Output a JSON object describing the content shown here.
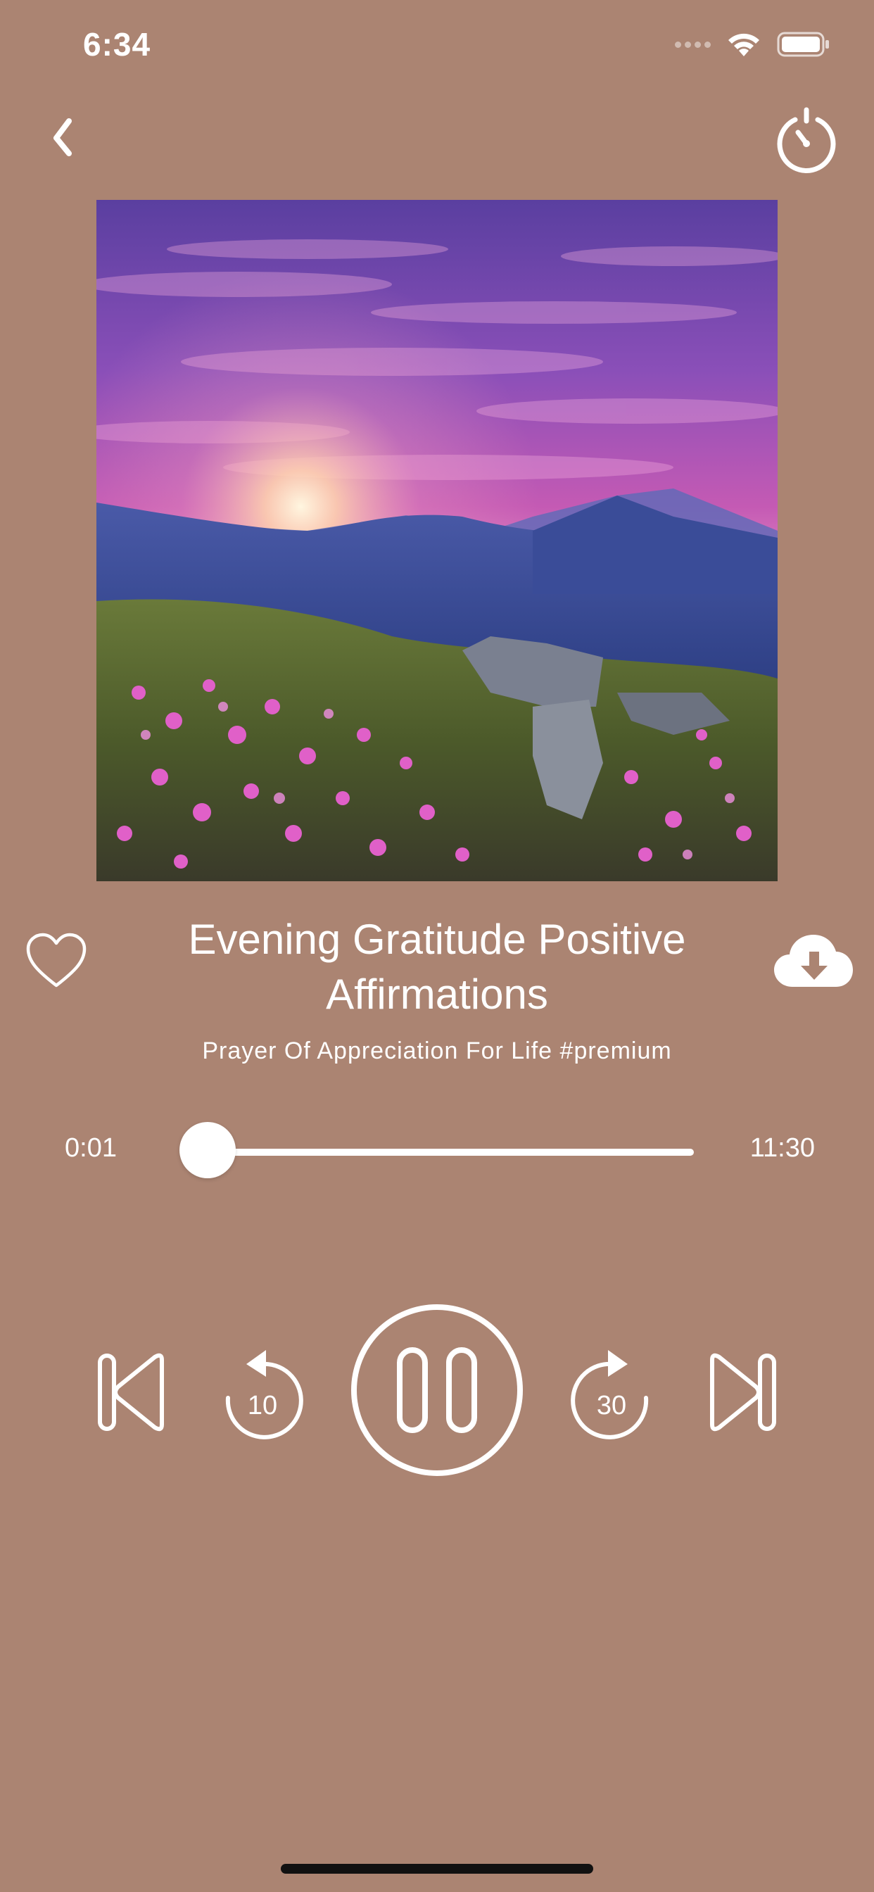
{
  "status_bar": {
    "time": "6:34",
    "icons": [
      "signal-icon",
      "wifi-icon",
      "battery-icon"
    ]
  },
  "nav": {
    "back_icon": "chevron-left-icon",
    "timer_icon": "sleep-timer-icon"
  },
  "artwork": {
    "description_icon": "album-artwork-image"
  },
  "track": {
    "title": "Evening Gratitude Positive Affirmations",
    "subtitle": "Prayer Of Appreciation For Life #premium",
    "favorite_icon": "heart-icon",
    "download_icon": "cloud-download-icon"
  },
  "progress": {
    "elapsed": "0:01",
    "total": "11:30",
    "fraction": 0.0015
  },
  "controls": {
    "previous_icon": "skip-previous-icon",
    "rewind_label": "10",
    "rewind_icon": "rewind-10-icon",
    "pause_icon": "pause-icon",
    "forward_label": "30",
    "forward_icon": "forward-30-icon",
    "next_icon": "skip-next-icon"
  },
  "colors": {
    "background": "#ab8472",
    "foreground": "#ffffff"
  }
}
